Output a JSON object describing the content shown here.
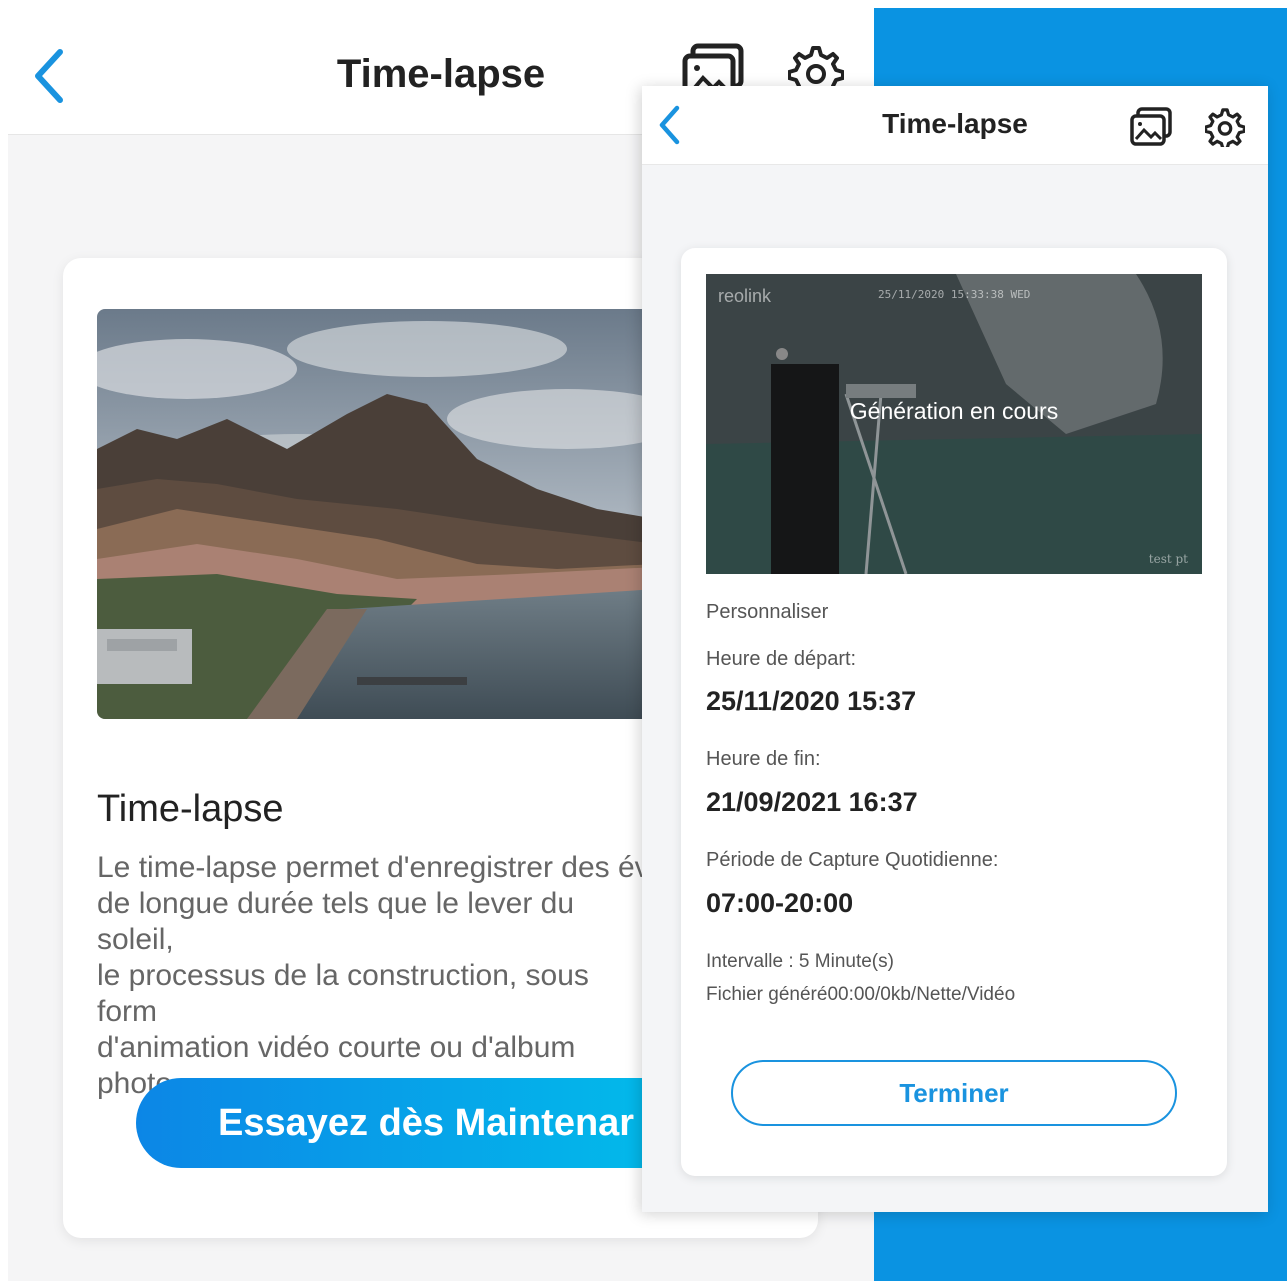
{
  "colors": {
    "accent": "#0a93e2",
    "button_gradient_start": "#0c86e6",
    "button_gradient_end": "#00c6ec",
    "outline_button": "#1a93df"
  },
  "back_screen": {
    "header": {
      "title": "Time-lapse",
      "back_icon": "chevron-left-icon",
      "gallery_icon": "gallery-icon",
      "settings_icon": "gear-icon"
    },
    "card": {
      "title": "Time-lapse",
      "description": "Le time-lapse permet d'enregistrer des év\nde longue durée tels que le lever du soleil,\nle processus de la construction, sous form\nd'animation vidéo courte ou d'album photo",
      "button_label": "Essayez dès Maintenar"
    }
  },
  "front_screen": {
    "header": {
      "title": "Time-lapse",
      "back_icon": "chevron-left-icon",
      "gallery_icon": "gallery-icon",
      "settings_icon": "gear-icon"
    },
    "preview": {
      "logo": "reolink",
      "timestamp": "25/11/2020 15:33:38 WED",
      "status": "Génération en cours",
      "camera_name": "test pt"
    },
    "details": {
      "mode": "Personnaliser",
      "start_label": "Heure de départ:",
      "start_value": "25/11/2020 15:37",
      "end_label": "Heure de fin:",
      "end_value": "21/09/2021 16:37",
      "period_label": "Période de Capture Quotidienne:",
      "period_value": "07:00-20:00",
      "interval": "Intervalle : 5 Minute(s)",
      "file_info": "Fichier généré00:00/0kb/Nette/Vidéo"
    },
    "finish_label": "Terminer"
  }
}
